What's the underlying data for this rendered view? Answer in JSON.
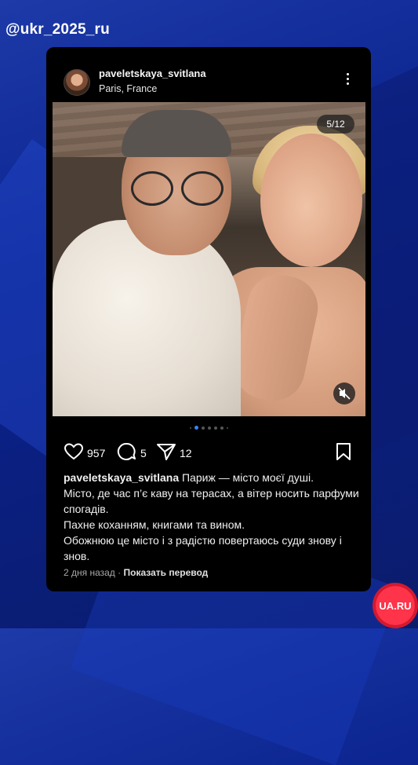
{
  "watermark": {
    "handle": "@ukr_2025_ru"
  },
  "post": {
    "username": "paveletskaya_svitlana",
    "location": "Paris, France",
    "media_counter": "5/12",
    "likes": "957",
    "comments": "5",
    "shares": "12",
    "caption": {
      "user": "paveletskaya_svitlana",
      "text": " Париж — місто моєї душі.\nМісто, де час п’є каву на терасах, а вітер носить парфуми спогадів.\nПахне коханням, книгами та вином.\nОбожнюю це місто і з радістю повертаюсь суди знову і знов."
    },
    "time_ago": "2 дня назад",
    "translate_link": "Показать перевод"
  },
  "brand": {
    "logo_text": "UA.RU"
  },
  "colors": {
    "accent": "#3b82f6",
    "logo_red": "#ff3349",
    "card_bg": "#000000"
  },
  "icons": [
    "more-icon",
    "mute-icon",
    "heart-icon",
    "comment-icon",
    "share-icon",
    "bookmark-icon"
  ]
}
